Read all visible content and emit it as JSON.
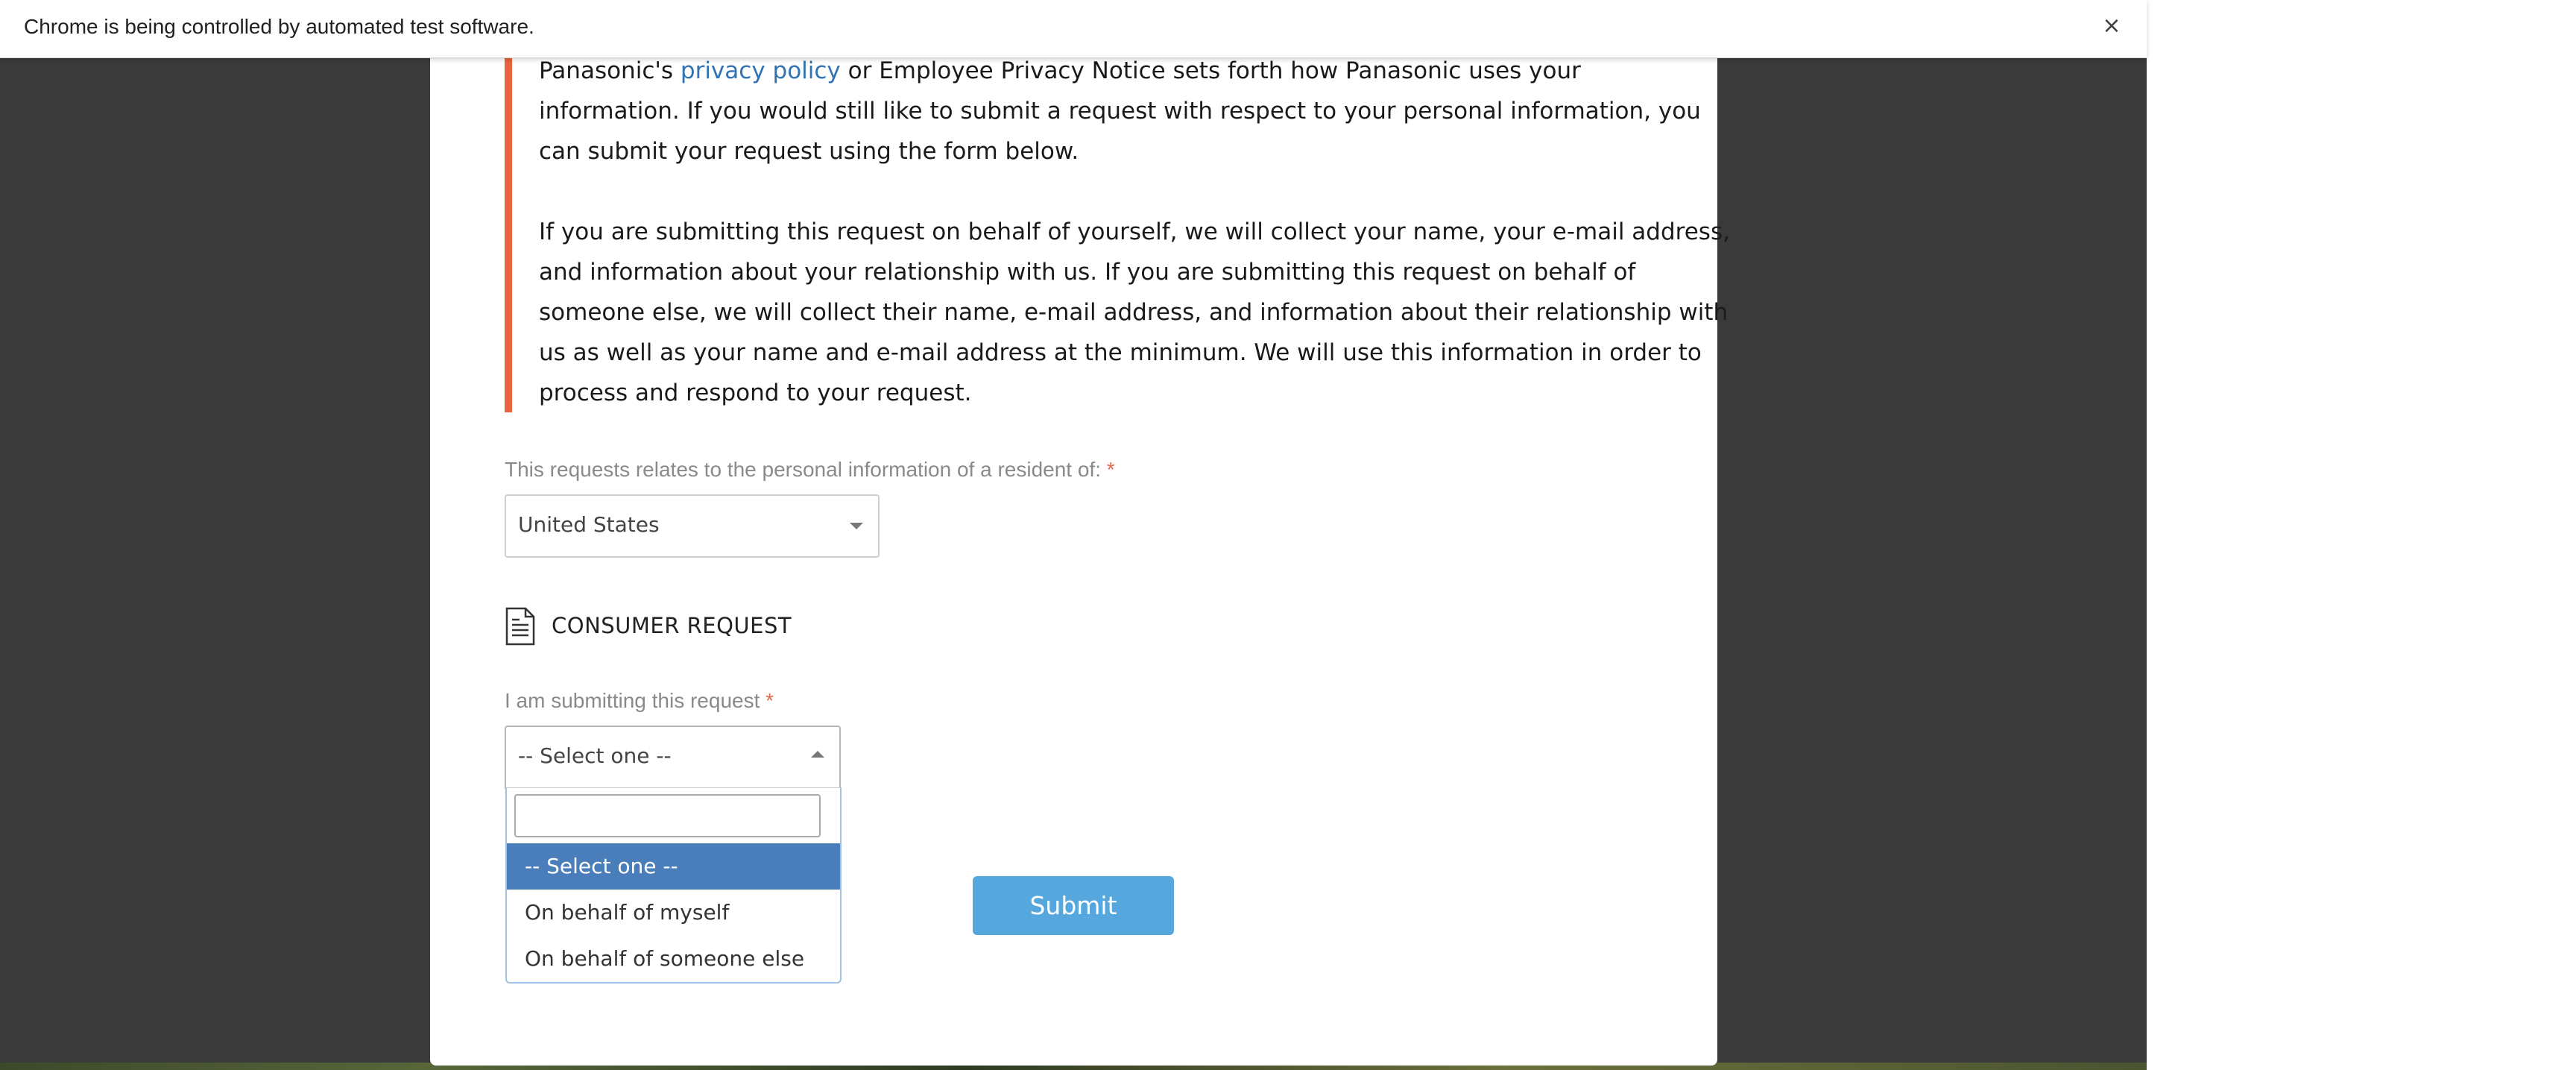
{
  "browser": {
    "infobar_message": "Chrome is being controlled by automated test software.",
    "close_icon": "×"
  },
  "notice": {
    "line1_prefix": "Panasonic's ",
    "line1_link": "privacy policy",
    "line1_suffix": " or Employee Privacy Notice sets forth how Panasonic uses your",
    "line2": "information. If you would still like to submit a request with respect to your personal information, you",
    "line3": "can submit your request using the form below.",
    "para2_line1": "If you are submitting this request on behalf of yourself, we will collect your name, your e-mail address,",
    "para2_line2": "and information about your relationship with us. If you are submitting this request on behalf of",
    "para2_line3": "someone else, we will collect their name, e-mail address, and information about their relationship with",
    "para2_line4": "us as well as your name and e-mail address at the minimum. We will use this information in order to",
    "para2_line5": "process and respond to your request.",
    "accent_color": "#e8643c"
  },
  "form": {
    "residency_label": "This requests relates to the personal information of a resident of:",
    "required_marker": "*",
    "residency_value": "United States",
    "section_title": "CONSUMER REQUEST",
    "section_icon": "document-icon",
    "request_label": "I am submitting this request",
    "request_value": "-- Select one --",
    "dropdown_search_value": "",
    "dropdown_options": [
      {
        "label": "-- Select one --",
        "selected": true
      },
      {
        "label": "On behalf of myself",
        "selected": false
      },
      {
        "label": "On behalf of someone else",
        "selected": false
      }
    ],
    "submit_label": "Submit",
    "submit_color": "#55a7dd",
    "selected_option_color": "#4a7ebb"
  }
}
